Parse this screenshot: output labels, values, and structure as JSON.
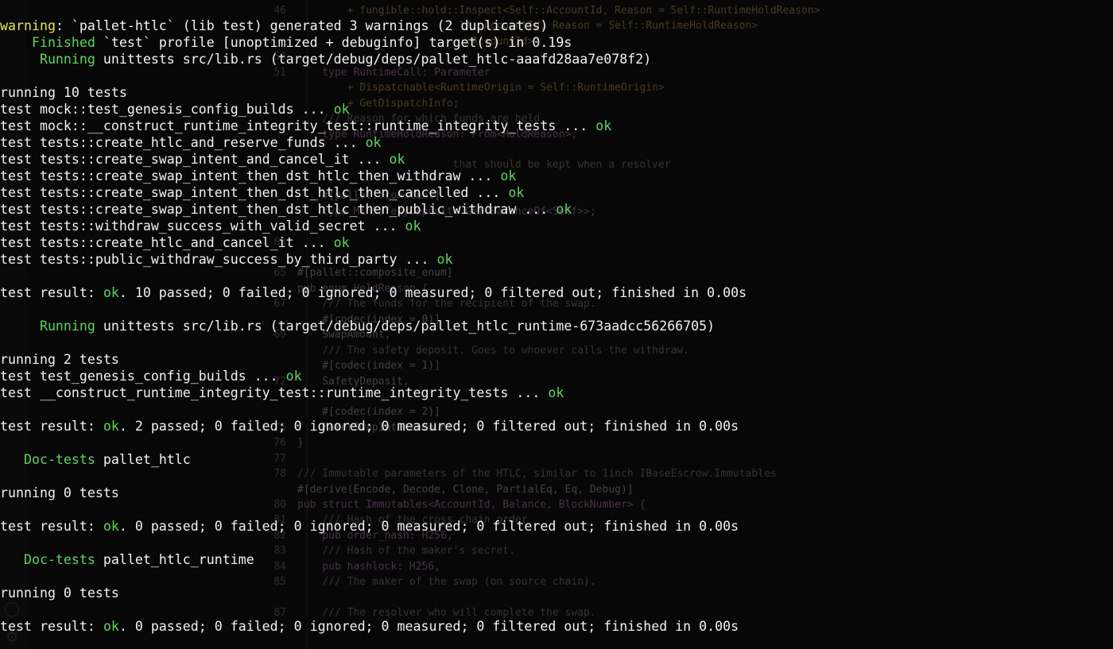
{
  "editor": {
    "lines": [
      {
        "num": "46",
        "text": "        + fungible::hold::Inspect<Self::AccountId, Reason = Self::RuntimeHoldReason>",
        "style": "type"
      },
      {
        "num": "",
        "text": "                          lf::AccountId, Reason = Self::RuntimeHoldReason>",
        "style": "type"
      },
      {
        "num": "",
        "text": "                          ::AccountId>",
        "style": "type"
      },
      {
        "num": "50",
        "text": "",
        "style": "plain"
      },
      {
        "num": "51",
        "text": "    type RuntimeCall: Parameter",
        "style": "kw"
      },
      {
        "num": "",
        "text": "        + Dispatchable<RuntimeOrigin = Self::RuntimeOrigin>",
        "style": "type"
      },
      {
        "num": "",
        "text": "        + GetDispatchInfo;",
        "style": "type"
      },
      {
        "num": "",
        "text": "    /// Reason for which funds are held.",
        "style": "comment"
      },
      {
        "num": "",
        "text": "    type RuntimeHoldReason: From<HoldReason>;",
        "style": "kw"
      },
      {
        "num": "",
        "text": "",
        "style": "plain"
      },
      {
        "num": "",
        "text": "                         that should be kept when a resolver",
        "style": "comment"
      },
      {
        "num": "",
        "text": "",
        "style": "plain"
      },
      {
        "num": "",
        "text": "    #[pallet::constant]",
        "style": "plain"
      },
      {
        "num": "",
        "text": "    type MinSafetyDeposit: Get<BalanceOf<Self>>;",
        "style": "kw"
      },
      {
        "num": "",
        "text": "",
        "style": "plain"
      },
      {
        "num": "63",
        "text": "",
        "style": "plain"
      },
      {
        "num": "",
        "text": "",
        "style": "plain"
      },
      {
        "num": "65",
        "text": "#[pallet::composite_enum]",
        "style": "plain"
      },
      {
        "num": "",
        "text": "pub enum HoldReason {",
        "style": "kw"
      },
      {
        "num": "67",
        "text": "    /// The funds for the recipient of the swap.",
        "style": "comment"
      },
      {
        "num": "",
        "text": "    #[codec(index = 0)]",
        "style": "plain"
      },
      {
        "num": "69",
        "text": "    SwapAmount,",
        "style": "plain"
      },
      {
        "num": "",
        "text": "    /// The safety deposit. Goes to whoever calls the withdraw.",
        "style": "comment"
      },
      {
        "num": "",
        "text": "    #[codec(index = 1)]",
        "style": "plain"
      },
      {
        "num": "72",
        "text": "    SafetyDeposit,",
        "style": "plain"
      },
      {
        "num": "",
        "text": "",
        "style": "plain"
      },
      {
        "num": "",
        "text": "    #[codec(index = 2)]",
        "style": "plain"
      },
      {
        "num": "75",
        "text": "    MakerSwapIntentAmount,",
        "style": "plain"
      },
      {
        "num": "76",
        "text": "}",
        "style": "plain"
      },
      {
        "num": "77",
        "text": "",
        "style": "plain"
      },
      {
        "num": "78",
        "text": "/// Immutable parameters of the HTLC, similar to 1inch IBaseEscrow.Immutables",
        "style": "comment"
      },
      {
        "num": "",
        "text": "#[derive(Encode, Decode, Clone, PartialEq, Eq, Debug)]",
        "style": "plain"
      },
      {
        "num": "80",
        "text": "pub struct Immutables<AccountId, Balance, BlockNumber> {",
        "style": "kw"
      },
      {
        "num": "81",
        "text": "    /// Hash of the cross chain order.",
        "style": "comment"
      },
      {
        "num": "82",
        "text": "    pub order_hash: H256,",
        "style": "kw"
      },
      {
        "num": "83",
        "text": "    /// Hash of the maker's secret.",
        "style": "comment"
      },
      {
        "num": "84",
        "text": "    pub hashlock: H256,",
        "style": "kw"
      },
      {
        "num": "85",
        "text": "    /// The maker of the swap (on source chain).",
        "style": "comment"
      },
      {
        "num": "",
        "text": "",
        "style": "plain"
      },
      {
        "num": "87",
        "text": "    /// The resolver who will complete the swap.",
        "style": "comment"
      }
    ],
    "side_icons": [
      "account-icon",
      "gear-icon"
    ]
  },
  "terminal": {
    "lines": [
      [
        {
          "t": "warning",
          "c": "warn"
        },
        {
          "t": ": `pallet-htlc` (lib test) generated 3 warnings (2 duplicates)",
          "c": "white"
        }
      ],
      [
        {
          "t": "    Finished",
          "c": "green"
        },
        {
          "t": " `test` profile [unoptimized + debuginfo] target(s) in 0.19s",
          "c": "white"
        }
      ],
      [
        {
          "t": "     Running",
          "c": "green"
        },
        {
          "t": " unittests src/lib.rs (target/debug/deps/pallet_htlc-aaafd28aa7e078f2)",
          "c": "white"
        }
      ],
      [],
      [
        {
          "t": "running 10 tests",
          "c": "white"
        }
      ],
      [
        {
          "t": "test mock::test_genesis_config_builds ... ",
          "c": "white"
        },
        {
          "t": "ok",
          "c": "ok"
        }
      ],
      [
        {
          "t": "test mock::__construct_runtime_integrity_test::runtime_integrity_tests ... ",
          "c": "white"
        },
        {
          "t": "ok",
          "c": "ok"
        }
      ],
      [
        {
          "t": "test tests::create_htlc_and_reserve_funds ... ",
          "c": "white"
        },
        {
          "t": "ok",
          "c": "ok"
        }
      ],
      [
        {
          "t": "test tests::create_swap_intent_and_cancel_it ... ",
          "c": "white"
        },
        {
          "t": "ok",
          "c": "ok"
        }
      ],
      [
        {
          "t": "test tests::create_swap_intent_then_dst_htlc_then_withdraw ... ",
          "c": "white"
        },
        {
          "t": "ok",
          "c": "ok"
        }
      ],
      [
        {
          "t": "test tests::create_swap_intent_then_dst_htlc_then_cancelled ... ",
          "c": "white"
        },
        {
          "t": "ok",
          "c": "ok"
        }
      ],
      [
        {
          "t": "test tests::create_swap_intent_then_dst_htlc_then_public_withdraw ... ",
          "c": "white"
        },
        {
          "t": "ok",
          "c": "ok"
        }
      ],
      [
        {
          "t": "test tests::withdraw_success_with_valid_secret ... ",
          "c": "white"
        },
        {
          "t": "ok",
          "c": "ok"
        }
      ],
      [
        {
          "t": "test tests::create_htlc_and_cancel_it ... ",
          "c": "white"
        },
        {
          "t": "ok",
          "c": "ok"
        }
      ],
      [
        {
          "t": "test tests::public_withdraw_success_by_third_party ... ",
          "c": "white"
        },
        {
          "t": "ok",
          "c": "ok"
        }
      ],
      [],
      [
        {
          "t": "test result: ",
          "c": "white"
        },
        {
          "t": "ok",
          "c": "ok"
        },
        {
          "t": ". 10 passed; 0 failed; 0 ignored; 0 measured; 0 filtered out; finished in 0.00s",
          "c": "white"
        }
      ],
      [],
      [
        {
          "t": "     Running",
          "c": "green"
        },
        {
          "t": " unittests src/lib.rs (target/debug/deps/pallet_htlc_runtime-673aadcc56266705)",
          "c": "white"
        }
      ],
      [],
      [
        {
          "t": "running 2 tests",
          "c": "white"
        }
      ],
      [
        {
          "t": "test test_genesis_config_builds ... ",
          "c": "white"
        },
        {
          "t": "ok",
          "c": "ok"
        }
      ],
      [
        {
          "t": "test __construct_runtime_integrity_test::runtime_integrity_tests ... ",
          "c": "white"
        },
        {
          "t": "ok",
          "c": "ok"
        }
      ],
      [],
      [
        {
          "t": "test result: ",
          "c": "white"
        },
        {
          "t": "ok",
          "c": "ok"
        },
        {
          "t": ". 2 passed; 0 failed; 0 ignored; 0 measured; 0 filtered out; finished in 0.00s",
          "c": "white"
        }
      ],
      [],
      [
        {
          "t": "   Doc-tests",
          "c": "green"
        },
        {
          "t": " pallet_htlc",
          "c": "white"
        }
      ],
      [],
      [
        {
          "t": "running 0 tests",
          "c": "white"
        }
      ],
      [],
      [
        {
          "t": "test result: ",
          "c": "white"
        },
        {
          "t": "ok",
          "c": "ok"
        },
        {
          "t": ". 0 passed; 0 failed; 0 ignored; 0 measured; 0 filtered out; finished in 0.00s",
          "c": "white"
        }
      ],
      [],
      [
        {
          "t": "   Doc-tests",
          "c": "green"
        },
        {
          "t": " pallet_htlc_runtime",
          "c": "white"
        }
      ],
      [],
      [
        {
          "t": "running 0 tests",
          "c": "white"
        }
      ],
      [],
      [
        {
          "t": "test result: ",
          "c": "white"
        },
        {
          "t": "ok",
          "c": "ok"
        },
        {
          "t": ". 0 passed; 0 failed; 0 ignored; 0 measured; 0 filtered out; finished in 0.00s",
          "c": "white"
        }
      ]
    ]
  },
  "colors": {
    "background": "#060606",
    "warning": "#e5e54c",
    "green": "#5fd35f",
    "text": "#f2f2f2"
  }
}
